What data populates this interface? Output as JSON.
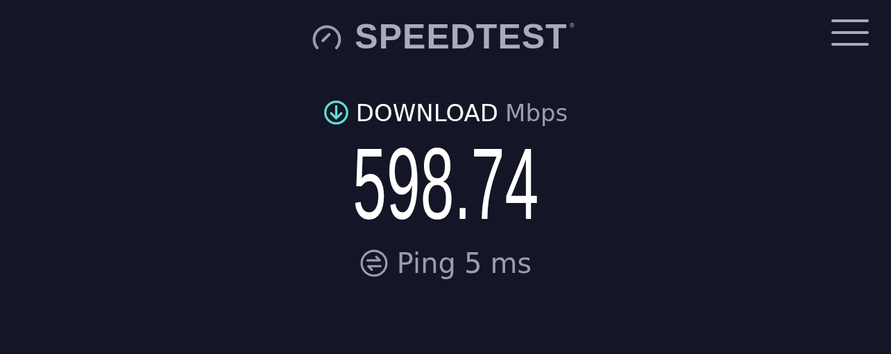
{
  "header": {
    "logo": "SPEEDTEST",
    "registered": "®"
  },
  "download": {
    "label": "DOWNLOAD",
    "unit": "Mbps",
    "value": "598.74"
  },
  "ping": {
    "label": "Ping",
    "value": "5",
    "unit": "ms"
  }
}
